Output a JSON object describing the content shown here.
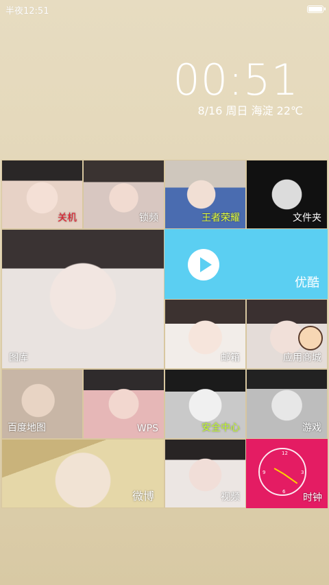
{
  "status_bar": {
    "time": "半夜12:51",
    "battery_level": 1.0
  },
  "lock_clock": {
    "time": "00:51",
    "date_weather": "8/16 周日  海淀 22℃"
  },
  "tiles": {
    "guanji": "关机",
    "suoping": "锁频",
    "wangzhe": "王者荣耀",
    "wenjianjia": "文件夹",
    "tuku": "图库",
    "youku": "优酷",
    "youxiang": "邮箱",
    "yingyong": "应用商城",
    "baidu_map": "百度地图",
    "wps": "WPS",
    "anquan": "安全中心",
    "youxi": "游戏",
    "weibo": "微博",
    "shipin": "视频",
    "shizhong": "时钟"
  },
  "colors": {
    "background": "#e4d8b9",
    "youku_tile": "#5bcff2",
    "clock_tile": "#e41c63",
    "clock_hands": "#ffd200"
  },
  "icons": {
    "youku": "play-icon",
    "clock": "analog-clock-icon"
  }
}
